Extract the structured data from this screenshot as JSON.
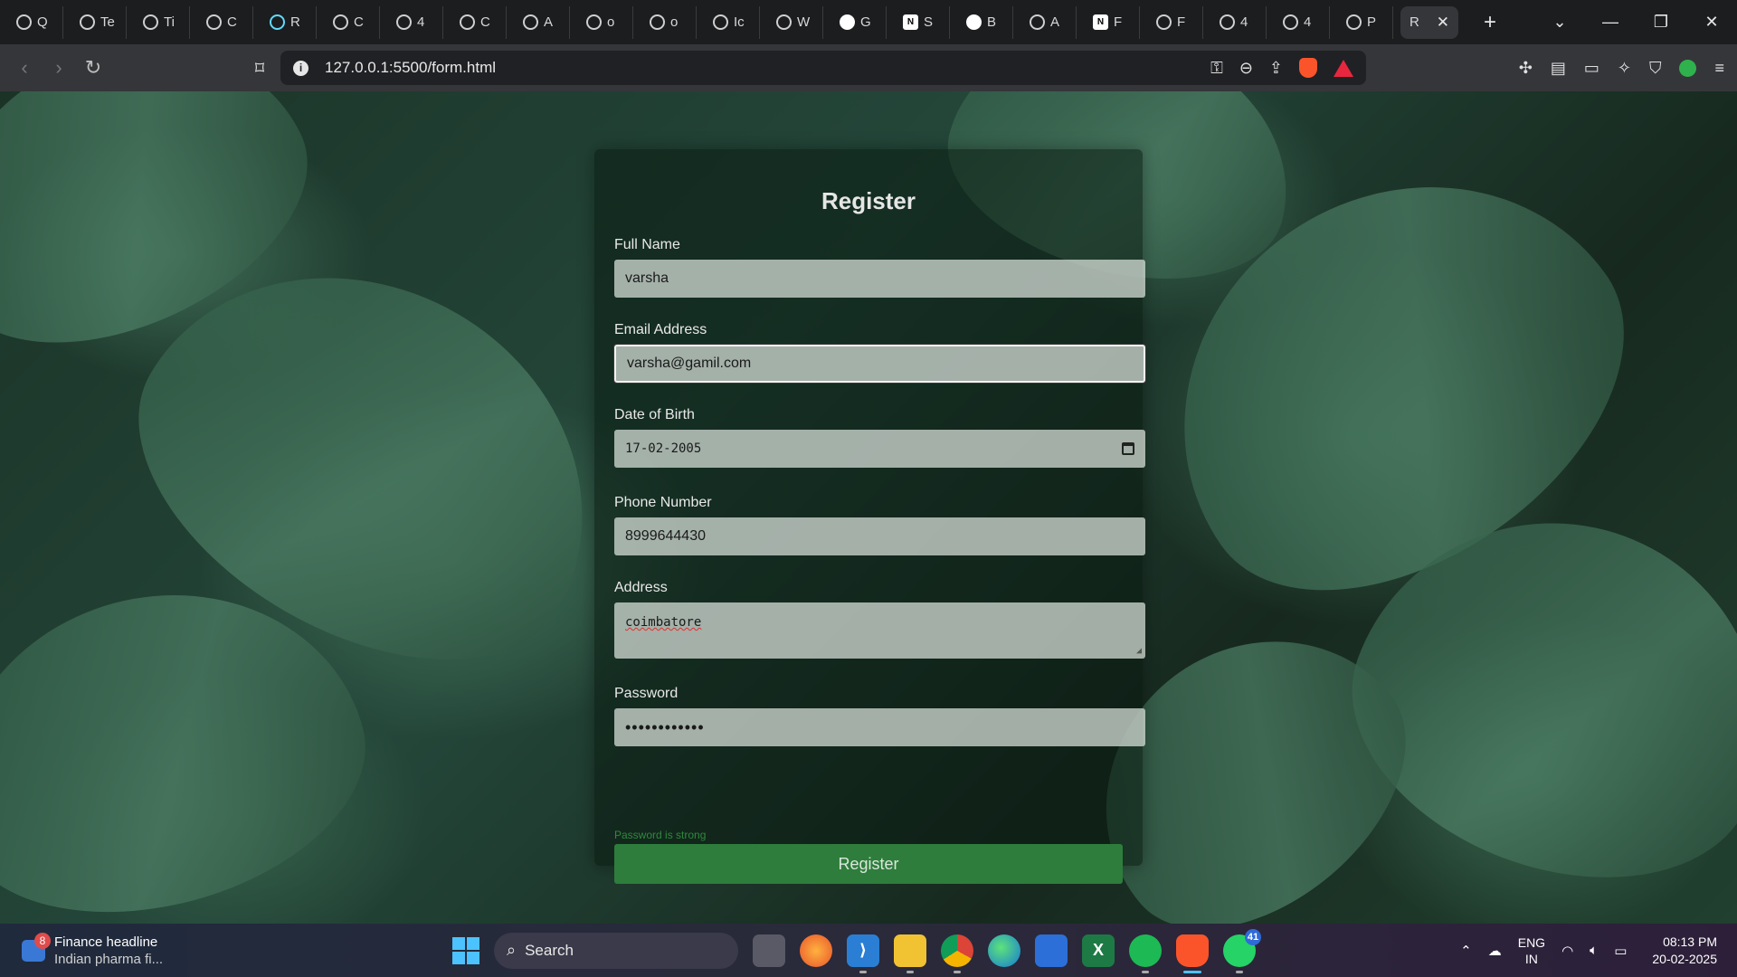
{
  "browser": {
    "tabs": [
      {
        "label": "Q",
        "icon": "globe-icon"
      },
      {
        "label": "Te",
        "icon": "globe-icon"
      },
      {
        "label": "Ti",
        "icon": "globe-icon"
      },
      {
        "label": "C",
        "icon": "globe-icon"
      },
      {
        "label": "R",
        "icon": "react-icon"
      },
      {
        "label": "C",
        "icon": "globe-icon"
      },
      {
        "label": "4",
        "icon": "globe-icon"
      },
      {
        "label": "C",
        "icon": "globe-icon"
      },
      {
        "label": "A",
        "icon": "globe-icon"
      },
      {
        "label": "o",
        "icon": "globe-icon"
      },
      {
        "label": "o",
        "icon": "globe-icon"
      },
      {
        "label": "Ic",
        "icon": "globe-icon"
      },
      {
        "label": "W",
        "icon": "globe-icon"
      },
      {
        "label": "G",
        "icon": "github-icon"
      },
      {
        "label": "S",
        "icon": "notion-icon"
      },
      {
        "label": "B",
        "icon": "github-icon"
      },
      {
        "label": "A",
        "icon": "globe-icon"
      },
      {
        "label": "F",
        "icon": "notion-icon"
      },
      {
        "label": "F",
        "icon": "globe-icon"
      },
      {
        "label": "4",
        "icon": "globe-icon"
      },
      {
        "label": "4",
        "icon": "globe-icon"
      },
      {
        "label": "P",
        "icon": "globe-icon"
      }
    ],
    "active_tab": {
      "label": "R",
      "close": "✕"
    },
    "new_tab": "+",
    "url": "127.0.0.1:5500/form.html"
  },
  "form": {
    "title": "Register",
    "full_name": {
      "label": "Full Name",
      "value": "varsha"
    },
    "email": {
      "label": "Email Address",
      "value": "varsha@gamil.com"
    },
    "dob": {
      "label": "Date of Birth",
      "value": "17-02-2005"
    },
    "phone": {
      "label": "Phone Number",
      "value": "8999644430"
    },
    "address": {
      "label": "Address",
      "value": "coimbatore"
    },
    "password": {
      "label": "Password",
      "value": "••••••••••••"
    },
    "password_strength": "Password is strong",
    "submit_label": "Register",
    "colors": {
      "button": "#2e7d3c",
      "strength_text": "#2f8a3a"
    }
  },
  "taskbar": {
    "widget": {
      "badge": "8",
      "title": "Finance headline",
      "subtitle": "Indian pharma fi..."
    },
    "search_label": "Search",
    "chrome_badge": "",
    "whatsapp_badge": "41",
    "lang_top": "ENG",
    "lang_bottom": "IN",
    "time": "08:13 PM",
    "date": "20-02-2025"
  }
}
